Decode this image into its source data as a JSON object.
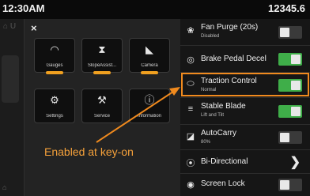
{
  "status_bar": {
    "time": "12:30AM",
    "hour_meter": "12345.6"
  },
  "background": {
    "ghost_top": "⌂ U",
    "ghost_bottom": "⌂"
  },
  "menu": {
    "close_label": "×",
    "tiles": [
      {
        "label": "Gauges",
        "icon": "gauge-icon",
        "glyph": "◠"
      },
      {
        "label": "SlopeAssist...",
        "icon": "slope-assist-icon",
        "glyph": "⧗"
      },
      {
        "label": "Camera",
        "icon": "camera-icon",
        "glyph": "◣"
      },
      {
        "label": "Settings",
        "icon": "gear-icon",
        "glyph": "⚙"
      },
      {
        "label": "Service",
        "icon": "wrench-icon",
        "glyph": "⚒"
      },
      {
        "label": "Information",
        "icon": "info-icon",
        "glyph": "ⓘ"
      }
    ]
  },
  "quick_settings": [
    {
      "icon": "fan-purge-icon",
      "glyph": "❀",
      "title": "Fan Purge (20s)",
      "subtitle": "Disabled",
      "control": "toggle",
      "state": "off"
    },
    {
      "icon": "brake-pedal-icon",
      "glyph": "◎",
      "title": "Brake Pedal Decel",
      "subtitle": "",
      "control": "toggle",
      "state": "on"
    },
    {
      "icon": "traction-control-icon",
      "glyph": "⬭",
      "title": "Traction Control",
      "subtitle": "Normal",
      "control": "toggle",
      "state": "on"
    },
    {
      "icon": "stable-blade-icon",
      "glyph": "≡",
      "title": "Stable Blade",
      "subtitle": "Lift and Tilt",
      "control": "toggle",
      "state": "on"
    },
    {
      "icon": "autocarry-icon",
      "glyph": "◪",
      "title": "AutoCarry",
      "subtitle": "80%",
      "control": "toggle",
      "state": "off"
    },
    {
      "icon": "bi-directional-icon",
      "glyph": "⦿",
      "title": "Bi-Directional",
      "subtitle": "",
      "control": "chevron",
      "chevron": "❯"
    },
    {
      "icon": "screen-lock-icon",
      "glyph": "◉",
      "title": "Screen Lock",
      "subtitle": "",
      "control": "toggle",
      "state": "off"
    }
  ],
  "annotation": {
    "text": "Enabled at key-on"
  },
  "colors": {
    "accent_orange": "#f08a1e",
    "toggle_on": "#3fae49",
    "toggle_off": "#3a3a3a"
  }
}
